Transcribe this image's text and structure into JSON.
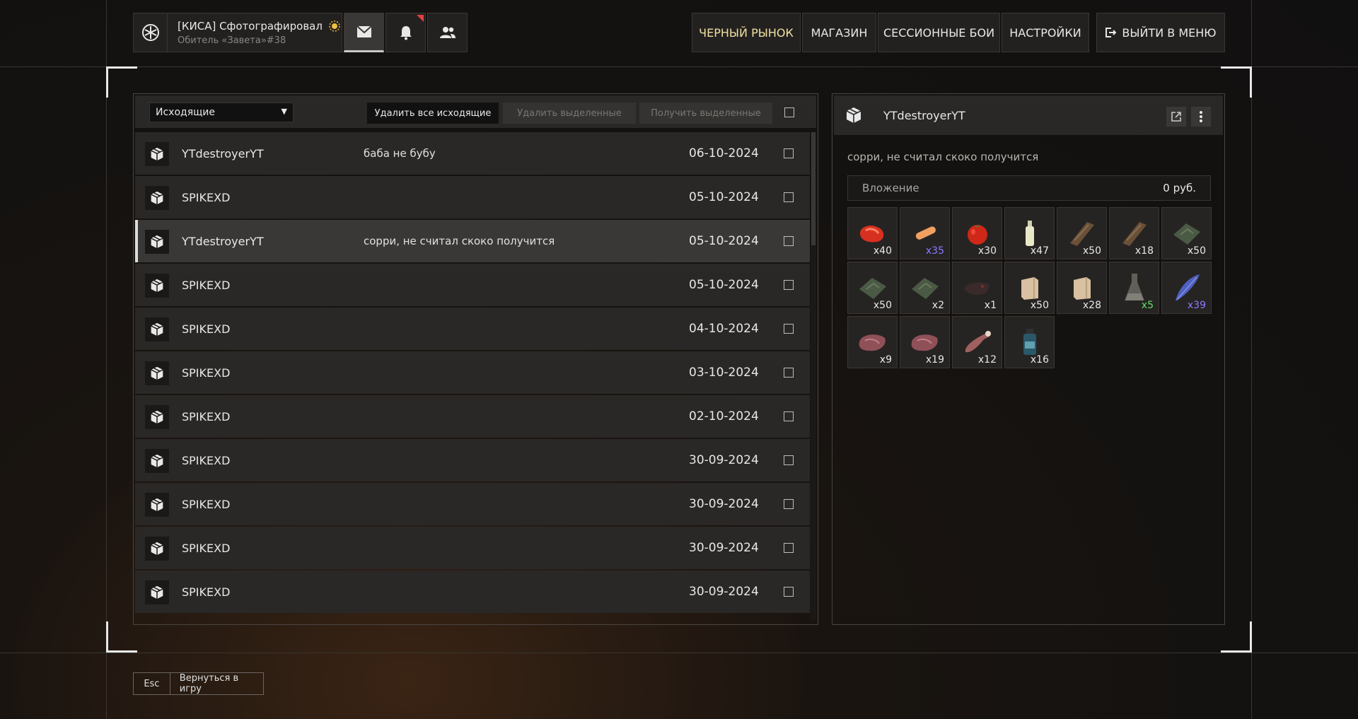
{
  "profile": {
    "name": "[КИСА] Сфотографировал",
    "subtitle": "Обитель «Завета»#38",
    "badge_icon": "sun-badge-icon",
    "avatar_icon": "star-crest-icon"
  },
  "header_icons": [
    "mail-icon",
    "bell-icon",
    "users-icon"
  ],
  "nav": {
    "black_market": "ЧЕРНЫЙ РЫНОК",
    "shop": "МАГАЗИН",
    "session_battles": "СЕССИОННЫЕ БОИ",
    "settings": "НАСТРОЙКИ",
    "exit": "ВЫЙТИ В МЕНЮ"
  },
  "colors": {
    "accent_gold": "#f0e0a0",
    "notif_red": "#e04040",
    "blue_count": "#8a7aff",
    "green_count": "#60e060"
  },
  "mail": {
    "filter_selected": "Исходящие",
    "delete_all_label": "Удалить все исходящие",
    "delete_selected_label": "Удалить выделенные",
    "receive_selected_label": "Получить выделенные",
    "rows": [
      {
        "sender": "YTdestroyerYT",
        "message": "баба не бубу",
        "date": "06-10-2024",
        "selected": false
      },
      {
        "sender": "SPIKEXD",
        "message": "",
        "date": "05-10-2024",
        "selected": false
      },
      {
        "sender": "YTdestroyerYT",
        "message": "сорри, не считал скоко получится",
        "date": "05-10-2024",
        "selected": true
      },
      {
        "sender": "SPIKEXD",
        "message": "",
        "date": "05-10-2024",
        "selected": false
      },
      {
        "sender": "SPIKEXD",
        "message": "",
        "date": "04-10-2024",
        "selected": false
      },
      {
        "sender": "SPIKEXD",
        "message": "",
        "date": "03-10-2024",
        "selected": false
      },
      {
        "sender": "SPIKEXD",
        "message": "",
        "date": "02-10-2024",
        "selected": false
      },
      {
        "sender": "SPIKEXD",
        "message": "",
        "date": "30-09-2024",
        "selected": false
      },
      {
        "sender": "SPIKEXD",
        "message": "",
        "date": "30-09-2024",
        "selected": false
      },
      {
        "sender": "SPIKEXD",
        "message": "",
        "date": "30-09-2024",
        "selected": false
      },
      {
        "sender": "SPIKEXD",
        "message": "",
        "date": "30-09-2024",
        "selected": false
      }
    ]
  },
  "detail": {
    "sender": "YTdestroyerYT",
    "message": "сорри, не считал скоко получится",
    "attachment_label": "Вложение",
    "attachment_value": "0 руб.",
    "items": [
      {
        "icon": "red-meat-item-icon",
        "count": "x40",
        "count_color": "#e8e8e8"
      },
      {
        "icon": "sausage-item-icon",
        "count": "x35",
        "count_color": "#8a7aff"
      },
      {
        "icon": "tomato-item-icon",
        "count": "x30",
        "count_color": "#e8e8e8"
      },
      {
        "icon": "bottle-item-icon",
        "count": "x47",
        "count_color": "#e8e8e8"
      },
      {
        "icon": "brown-strip-item-icon",
        "count": "x50",
        "count_color": "#e8e8e8"
      },
      {
        "icon": "brown-strip-item-icon",
        "count": "x18",
        "count_color": "#e8e8e8"
      },
      {
        "icon": "green-cloth-item-icon",
        "count": "x50",
        "count_color": "#e8e8e8"
      },
      {
        "icon": "green-cloth-item-icon",
        "count": "x50",
        "count_color": "#e8e8e8"
      },
      {
        "icon": "green-cloth-item-icon",
        "count": "x2",
        "count_color": "#e8e8e8"
      },
      {
        "icon": "creature-head-item-icon",
        "count": "x1",
        "count_color": "#e8e8e8"
      },
      {
        "icon": "paper-bag-item-icon",
        "count": "x50",
        "count_color": "#e8e8e8"
      },
      {
        "icon": "paper-bag-item-icon",
        "count": "x28",
        "count_color": "#e8e8e8"
      },
      {
        "icon": "flask-item-icon",
        "count": "x5",
        "count_color": "#60e060"
      },
      {
        "icon": "blue-feather-item-icon",
        "count": "x39",
        "count_color": "#8a7aff"
      },
      {
        "icon": "raw-meat-item-icon",
        "count": "x9",
        "count_color": "#e8e8e8"
      },
      {
        "icon": "raw-meat-item-icon",
        "count": "x19",
        "count_color": "#e8e8e8"
      },
      {
        "icon": "bone-meat-item-icon",
        "count": "x12",
        "count_color": "#e8e8e8"
      },
      {
        "icon": "medicine-bottle-item-icon",
        "count": "x16",
        "count_color": "#e8e8e8"
      }
    ]
  },
  "footer": {
    "key": "Esc",
    "label": "Вернуться в игру"
  }
}
